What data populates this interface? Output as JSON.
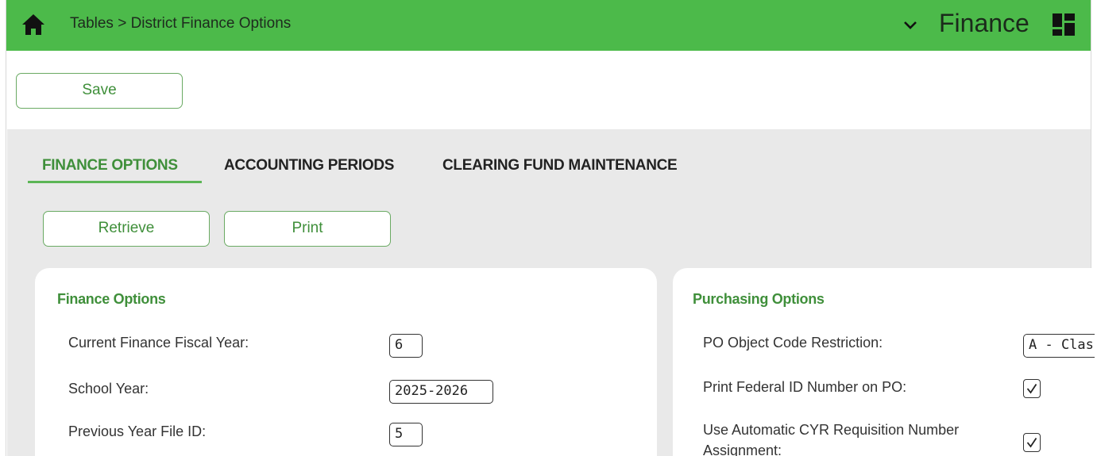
{
  "header": {
    "breadcrumb": "Tables > District Finance Options",
    "module_title": "Finance",
    "bar_color": "#4cba4a",
    "icons": [
      "home-icon",
      "chevron-down-icon",
      "grid-menu-icon"
    ]
  },
  "toolbar": {
    "save_label": "Save"
  },
  "tabs": [
    {
      "label": "FINANCE OPTIONS",
      "active": true
    },
    {
      "label": "ACCOUNTING PERIODS",
      "active": false
    },
    {
      "label": "CLEARING FUND MAINTENANCE",
      "active": false
    }
  ],
  "actions": {
    "retrieve_label": "Retrieve",
    "print_label": "Print"
  },
  "finance_options": {
    "title": "Finance Options",
    "fields": [
      {
        "label": "Current Finance Fiscal Year:",
        "value": "6"
      },
      {
        "label": "School Year:",
        "value": "2025-2026"
      },
      {
        "label": "Previous Year File ID:",
        "value": "5"
      }
    ]
  },
  "purchasing_options": {
    "title": "Purchasing Options",
    "po_object_code_restriction": {
      "label": "PO Object Code Restriction:",
      "value": "A - Clas"
    },
    "print_federal_id": {
      "label": "Print Federal ID Number on PO:",
      "checked": true
    },
    "auto_cyr_requisition": {
      "label_line1": "Use Automatic CYR Requisition Number",
      "label_line2": "Assignment:",
      "checked": true
    }
  },
  "colors": {
    "accent": "#3f8f3a",
    "content_bg": "#e9e9e9"
  }
}
